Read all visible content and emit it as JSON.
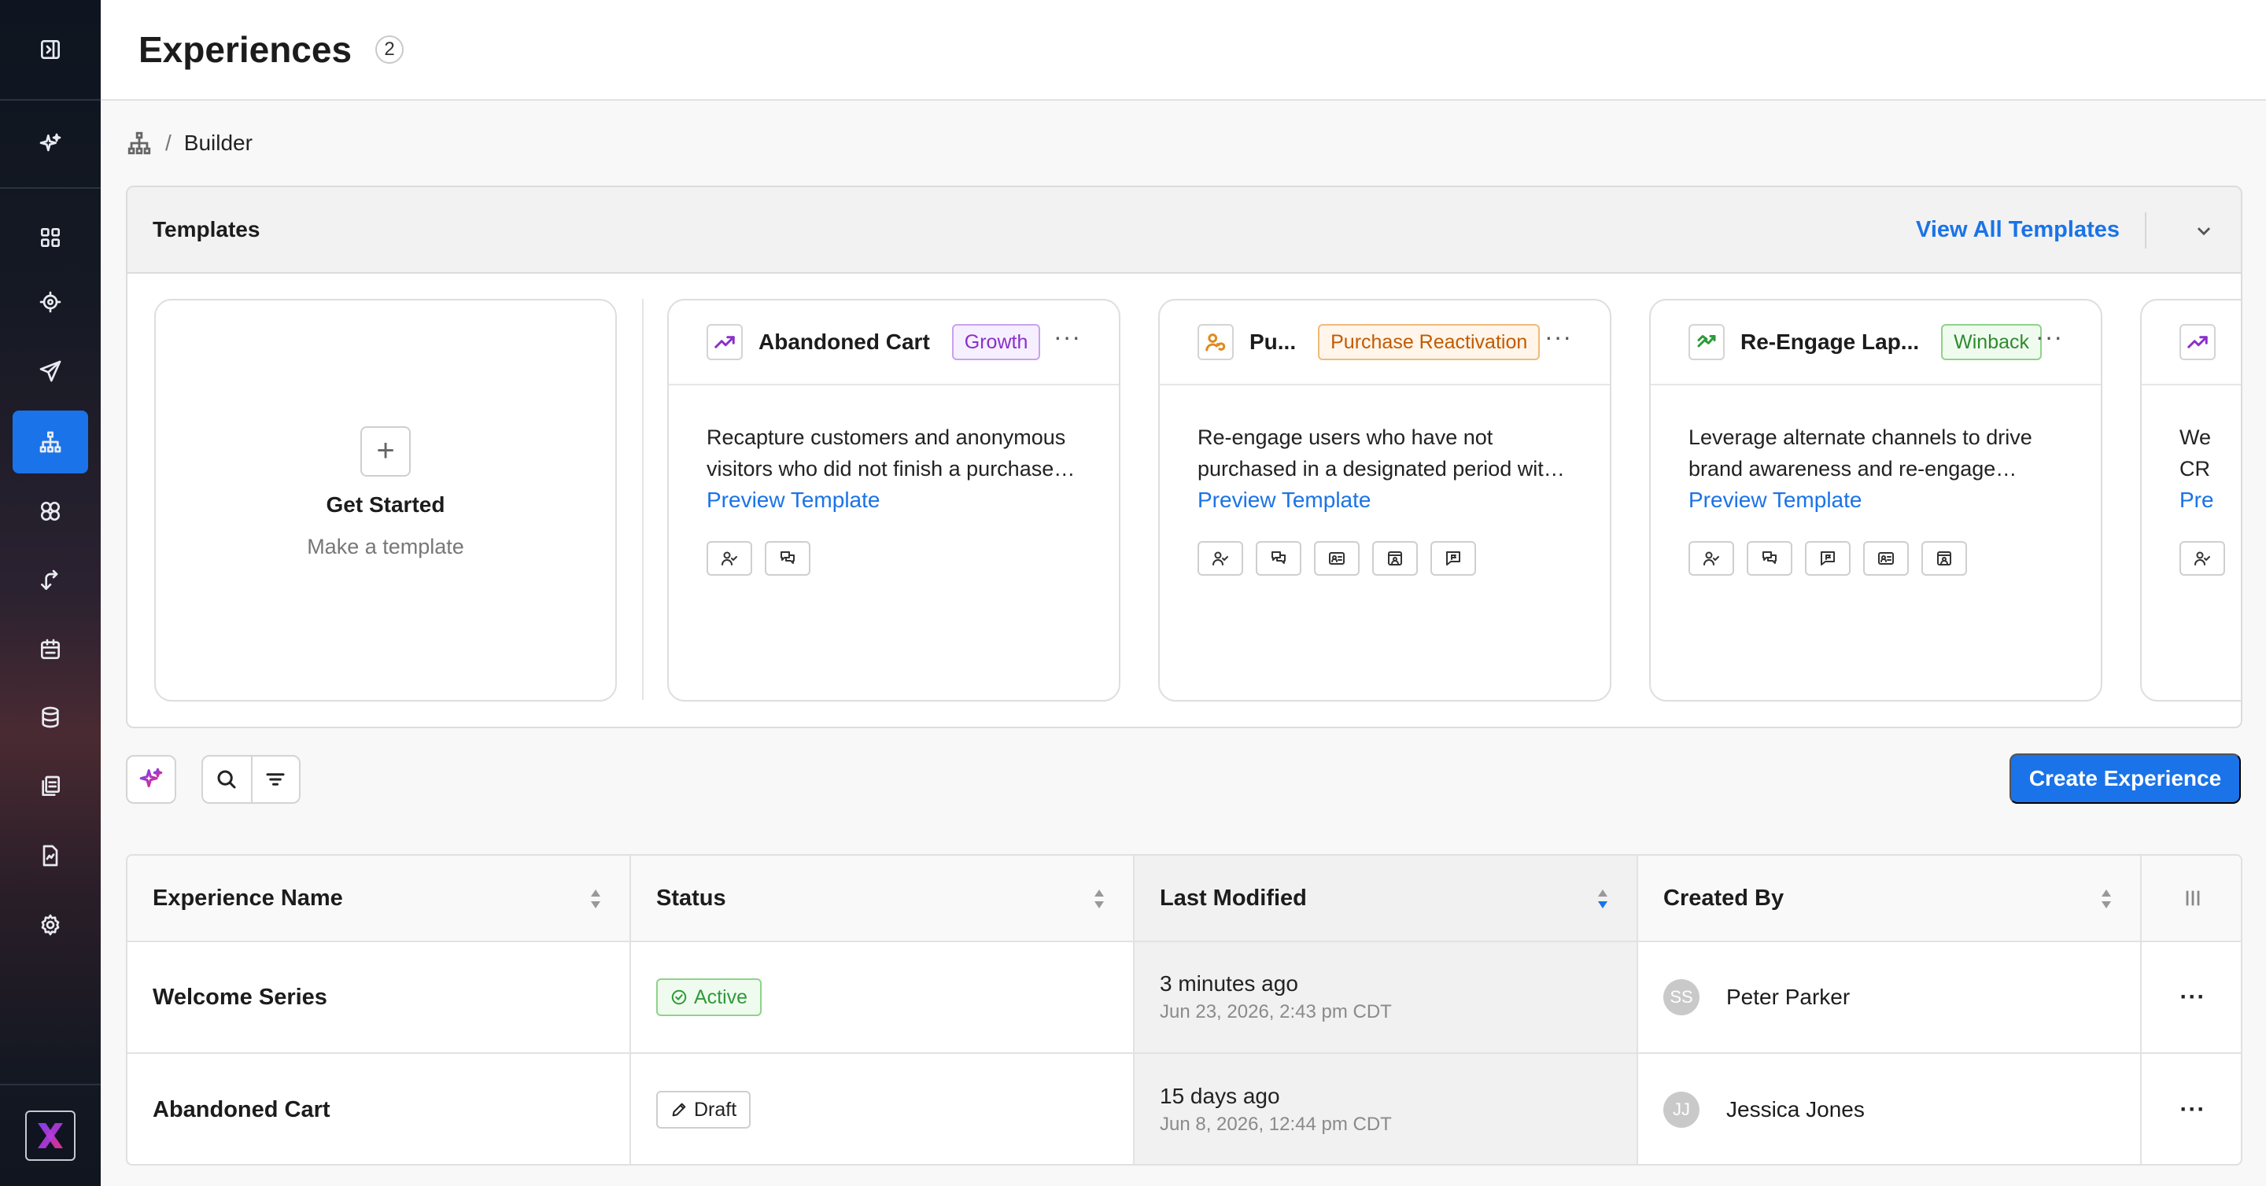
{
  "header": {
    "title": "Experiences",
    "count": "2"
  },
  "breadcrumb": {
    "current": "Builder",
    "separator": "/"
  },
  "sidebar": {
    "items": [
      {
        "icon": "dashboard-icon"
      },
      {
        "icon": "target-icon"
      },
      {
        "icon": "send-icon"
      },
      {
        "icon": "sitemap-icon",
        "active": true
      },
      {
        "icon": "segments-icon"
      },
      {
        "icon": "return-icon"
      },
      {
        "icon": "calendar-icon"
      },
      {
        "icon": "database-icon"
      },
      {
        "icon": "library-icon"
      },
      {
        "icon": "report-icon"
      },
      {
        "icon": "settings-icon"
      }
    ]
  },
  "templates": {
    "title": "Templates",
    "view_all": "View All Templates",
    "get_started": {
      "title": "Get Started",
      "subtitle": "Make a template"
    },
    "cards": [
      {
        "title": "Abandoned Cart",
        "tag": "Growth",
        "description": "Recapture customers and anonymous visitors who did not finish a purchase…",
        "link": "Preview Template"
      },
      {
        "title": "Pu...",
        "tag": "Purchase Reactivation",
        "description": "Re-engage users who have not purchased in a designated period wit…",
        "link": "Preview Template"
      },
      {
        "title": "Re-Engage Lap...",
        "tag": "Winback",
        "description": "Leverage alternate channels to drive brand awareness and re-engage user…",
        "link": "Preview Template"
      },
      {
        "title": "",
        "tag": "",
        "description": "We CRI",
        "link": "Pre"
      }
    ]
  },
  "toolbar": {
    "create_label": "Create Experience"
  },
  "table": {
    "columns": [
      "Experience Name",
      "Status",
      "Last Modified",
      "Created By"
    ],
    "rows": [
      {
        "name": "Welcome Series",
        "status": "Active",
        "modified_relative": "3 minutes ago",
        "modified_absolute": "Jun 23, 2026, 2:43 pm CDT",
        "initials": "SS",
        "creator": "Peter Parker"
      },
      {
        "name": "Abandoned Cart",
        "status": "Draft",
        "modified_relative": "15 days ago",
        "modified_absolute": "Jun 8, 2026, 12:44 pm CDT",
        "initials": "JJ",
        "creator": "Jessica Jones"
      }
    ]
  },
  "colors": {
    "accent": "#1a73e8",
    "growth": "#8b2fc9",
    "purchase": "#c35a00",
    "winback": "#2e8b2e"
  }
}
